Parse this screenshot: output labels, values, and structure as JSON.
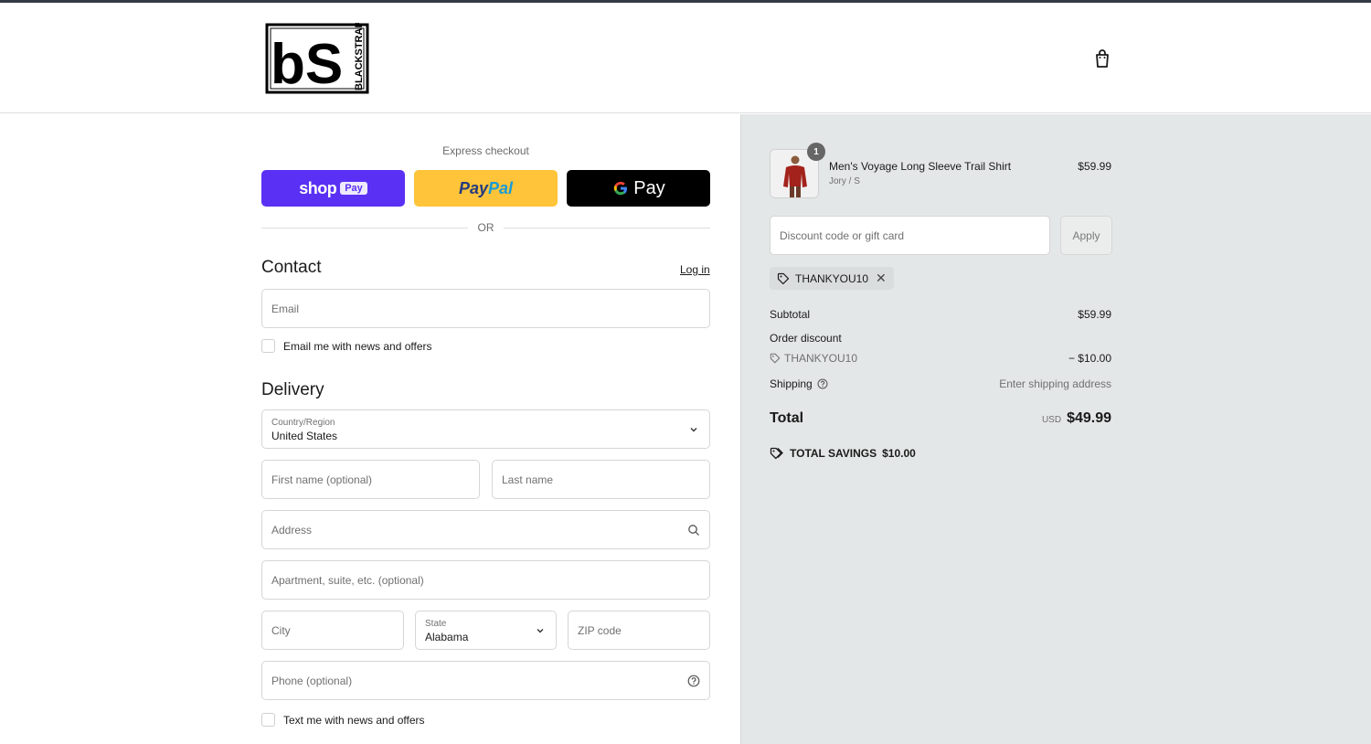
{
  "header": {
    "logo_letters": "bS",
    "logo_brand": "BLACKSTRAP",
    "cart_icon": "shopping-bag-icon"
  },
  "express": {
    "title": "Express checkout",
    "shop_pay_word": "shop",
    "shop_pay_pill": "Pay",
    "paypal_part1": "Pay",
    "paypal_part2": "Pal",
    "gpay_g": "G",
    "gpay_word": "Pay",
    "or_text": "OR"
  },
  "contact": {
    "title": "Contact",
    "login_label": "Log in",
    "email_placeholder": "Email",
    "news_label": "Email me with news and offers"
  },
  "delivery": {
    "title": "Delivery",
    "country_label": "Country/Region",
    "country_value": "United States",
    "first_name_placeholder": "First name (optional)",
    "last_name_placeholder": "Last name",
    "address_placeholder": "Address",
    "apartment_placeholder": "Apartment, suite, etc. (optional)",
    "city_placeholder": "City",
    "state_label": "State",
    "state_value": "Alabama",
    "zip_placeholder": "ZIP code",
    "phone_placeholder": "Phone (optional)",
    "text_label": "Text me with news and offers"
  },
  "order": {
    "item": {
      "quantity": "1",
      "name": "Men's Voyage Long Sleeve Trail Shirt",
      "variant": "Jory / S",
      "price": "$59.99"
    },
    "discount_placeholder": "Discount code or gift card",
    "apply_label": "Apply",
    "applied_code": "THANKYOU10",
    "subtotal_label": "Subtotal",
    "subtotal_value": "$59.99",
    "order_discount_label": "Order discount",
    "discount_code": "THANKYOU10",
    "discount_value": "− $10.00",
    "shipping_label": "Shipping",
    "shipping_value": "Enter shipping address",
    "total_label": "Total",
    "total_currency": "USD",
    "total_value": "$49.99",
    "savings_label": "TOTAL SAVINGS",
    "savings_value": "$10.00"
  },
  "colors": {
    "shop_pay": "#5a31f4",
    "paypal": "#ffc439",
    "gpay": "#000000",
    "summary_bg": "#e4e7e7"
  }
}
